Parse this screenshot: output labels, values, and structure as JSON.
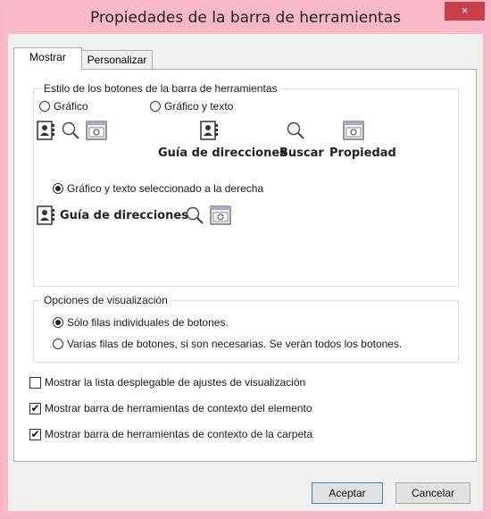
{
  "window": {
    "title": "Propiedades de la barra de herramientas",
    "close_label": "×"
  },
  "tabs": [
    {
      "label": "Mostrar"
    },
    {
      "label": "Personalizar"
    }
  ],
  "style_group": {
    "label": "Estilo de los botones de la barra de herramientas",
    "option_graphic": "Gráfico",
    "option_graphic_text": "Gráfico y texto",
    "option_graphic_text_right": "Gráfico y texto seleccionado a la derecha",
    "selected": "option_graphic_text_right",
    "buttons": {
      "address_guide": "Guía de direcciones",
      "search": "Buscar",
      "property": "Propiedad"
    }
  },
  "display_group": {
    "label": "Opciones de visualización",
    "option_single_rows": "Sólo filas individuales de botones.",
    "option_multi_rows": "Varias filas de botones, si son necesarias. Se verán todos los botones.",
    "selected": "option_single_rows"
  },
  "checkboxes": [
    {
      "label": "Mostrar la lista desplegable de ajustes de visualización",
      "checked": false
    },
    {
      "label": "Mostrar barra de herramientas de contexto del elemento",
      "checked": true
    },
    {
      "label": "Mostrar barra de herramientas de contexto de la carpeta",
      "checked": true
    }
  ],
  "footer": {
    "accept_label": "Aceptar",
    "cancel_label": "Cancelar"
  },
  "check_glyph": "✔"
}
